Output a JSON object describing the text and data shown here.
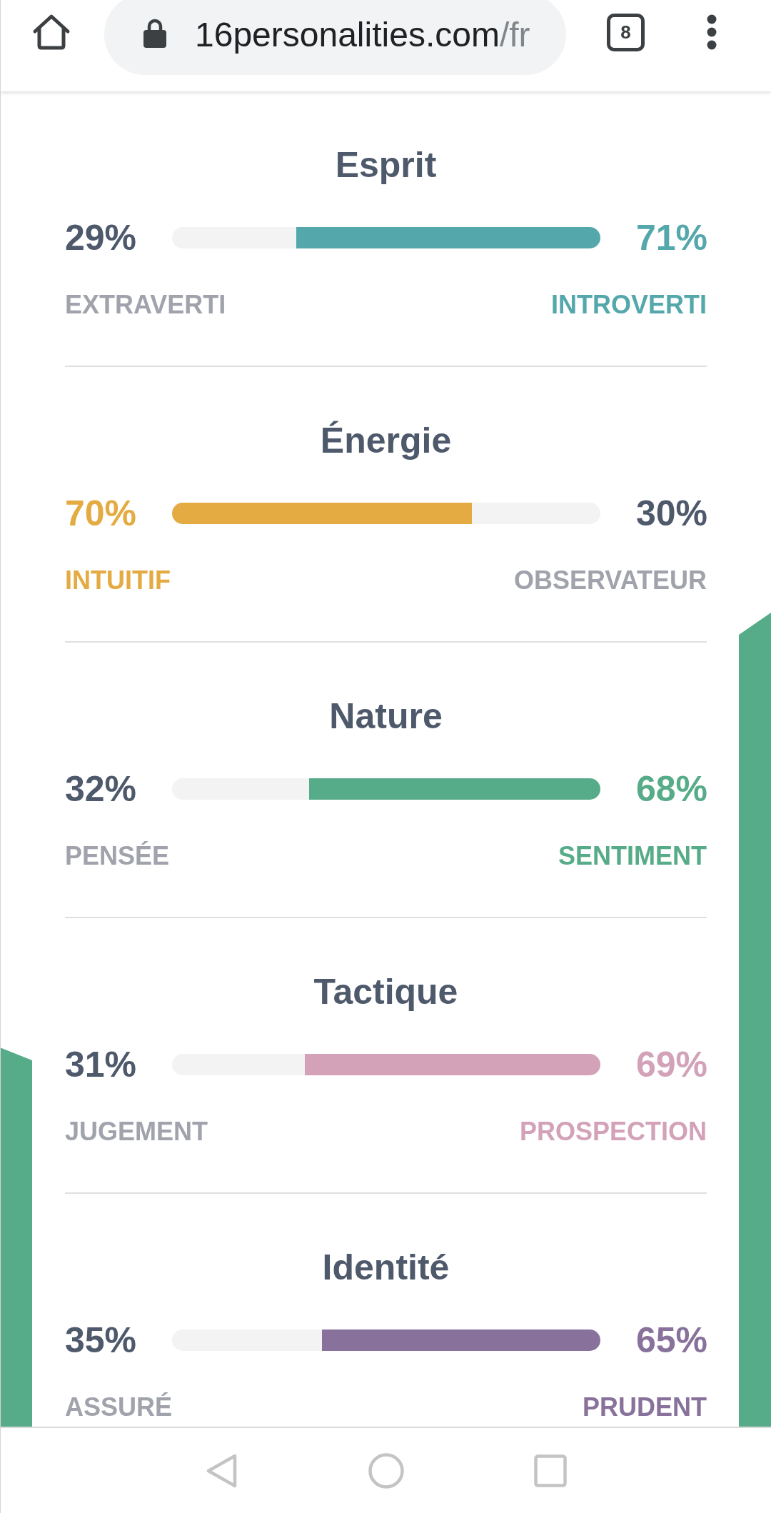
{
  "browser_bar": {
    "url_host": "16personalities.com",
    "url_path": "/fr",
    "tab_count": "8"
  },
  "traits": [
    {
      "title": "Esprit",
      "color": "#54a8ab",
      "level": 0.71,
      "left": {
        "percent": "29%",
        "label": "EXTRAVERTI",
        "selected": false
      },
      "right": {
        "percent": "71%",
        "label": "INTROVERTI",
        "selected": true
      }
    },
    {
      "title": "Énergie",
      "color": "#e4ab42",
      "level": 0.7,
      "left": {
        "percent": "70%",
        "label": "INTUITIF",
        "selected": true
      },
      "right": {
        "percent": "30%",
        "label": "OBSERVATEUR",
        "selected": false
      }
    },
    {
      "title": "Nature",
      "color": "#56ab89",
      "level": 0.68,
      "left": {
        "percent": "32%",
        "label": "PENSÉE",
        "selected": false
      },
      "right": {
        "percent": "68%",
        "label": "SENTIMENT",
        "selected": true
      }
    },
    {
      "title": "Tactique",
      "color": "#d3a2b8",
      "level": 0.69,
      "left": {
        "percent": "31%",
        "label": "JUGEMENT",
        "selected": false
      },
      "right": {
        "percent": "69%",
        "label": "PROSPECTION",
        "selected": true
      }
    },
    {
      "title": "Identité",
      "color": "#88729b",
      "level": 0.65,
      "left": {
        "percent": "35%",
        "label": "ASSURÉ",
        "selected": false
      },
      "right": {
        "percent": "65%",
        "label": "PRUDENT",
        "selected": true
      }
    }
  ]
}
